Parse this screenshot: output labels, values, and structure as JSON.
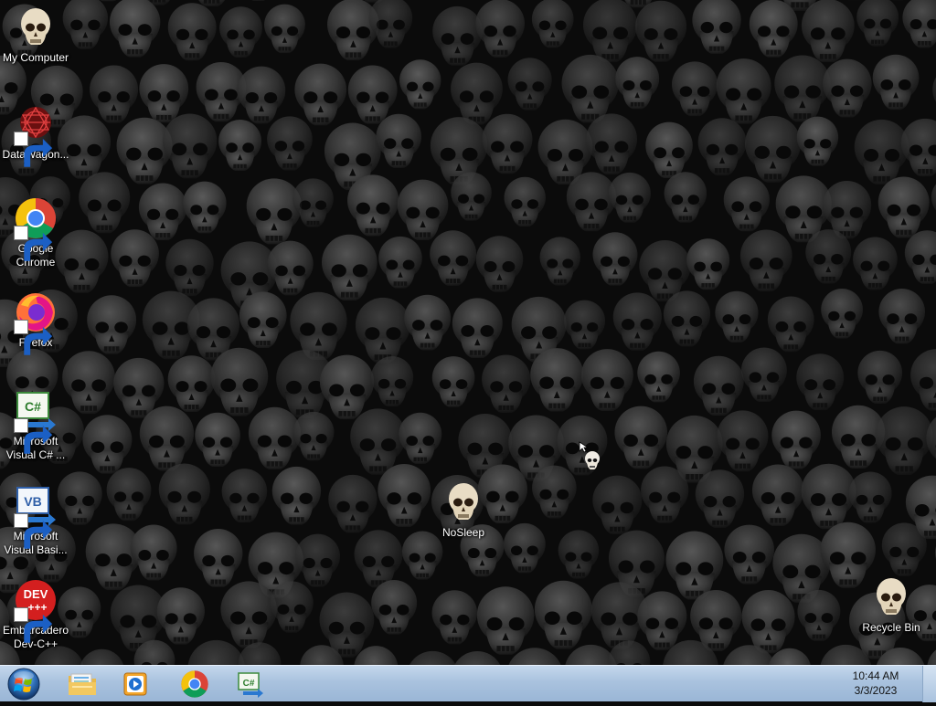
{
  "desktop": {
    "icons": [
      {
        "label": "My Computer",
        "icon": "skull-icon"
      },
      {
        "label": "DataWagon...",
        "icon": "datawagon-icon"
      },
      {
        "label": "Google Chrome",
        "icon": "chrome-icon"
      },
      {
        "label": "Firefox",
        "icon": "firefox-icon"
      },
      {
        "label": "Microsoft Visual C# ...",
        "icon": "visual-csharp-icon"
      },
      {
        "label": "Microsoft Visual Basi...",
        "icon": "visual-basic-icon"
      },
      {
        "label": "Embarcadero Dev-C++",
        "icon": "devcpp-icon"
      },
      {
        "label": "NoSleep",
        "icon": "skull-icon"
      },
      {
        "label": "Recycle Bin",
        "icon": "skull-icon"
      }
    ],
    "dev_icon_text": "DEV",
    "dev_icon_plus": "+++",
    "csharp_icon_text": "C#",
    "vb_icon_text": "VB"
  },
  "taskbar": {
    "pinned": [
      {
        "name": "windows-explorer",
        "icon": "folder-icon"
      },
      {
        "name": "media-player",
        "icon": "media-player-icon"
      },
      {
        "name": "google-chrome",
        "icon": "chrome-icon"
      },
      {
        "name": "visual-csharp",
        "icon": "visual-csharp-icon"
      }
    ],
    "taskbar_csharp_text": "C#",
    "clock": {
      "time": "10:44 AM",
      "date": "3/3/2023"
    }
  },
  "colors": {
    "taskbar": "#a9c2de",
    "wallpaper": "#0b0b0b",
    "label": "#ffffff"
  }
}
